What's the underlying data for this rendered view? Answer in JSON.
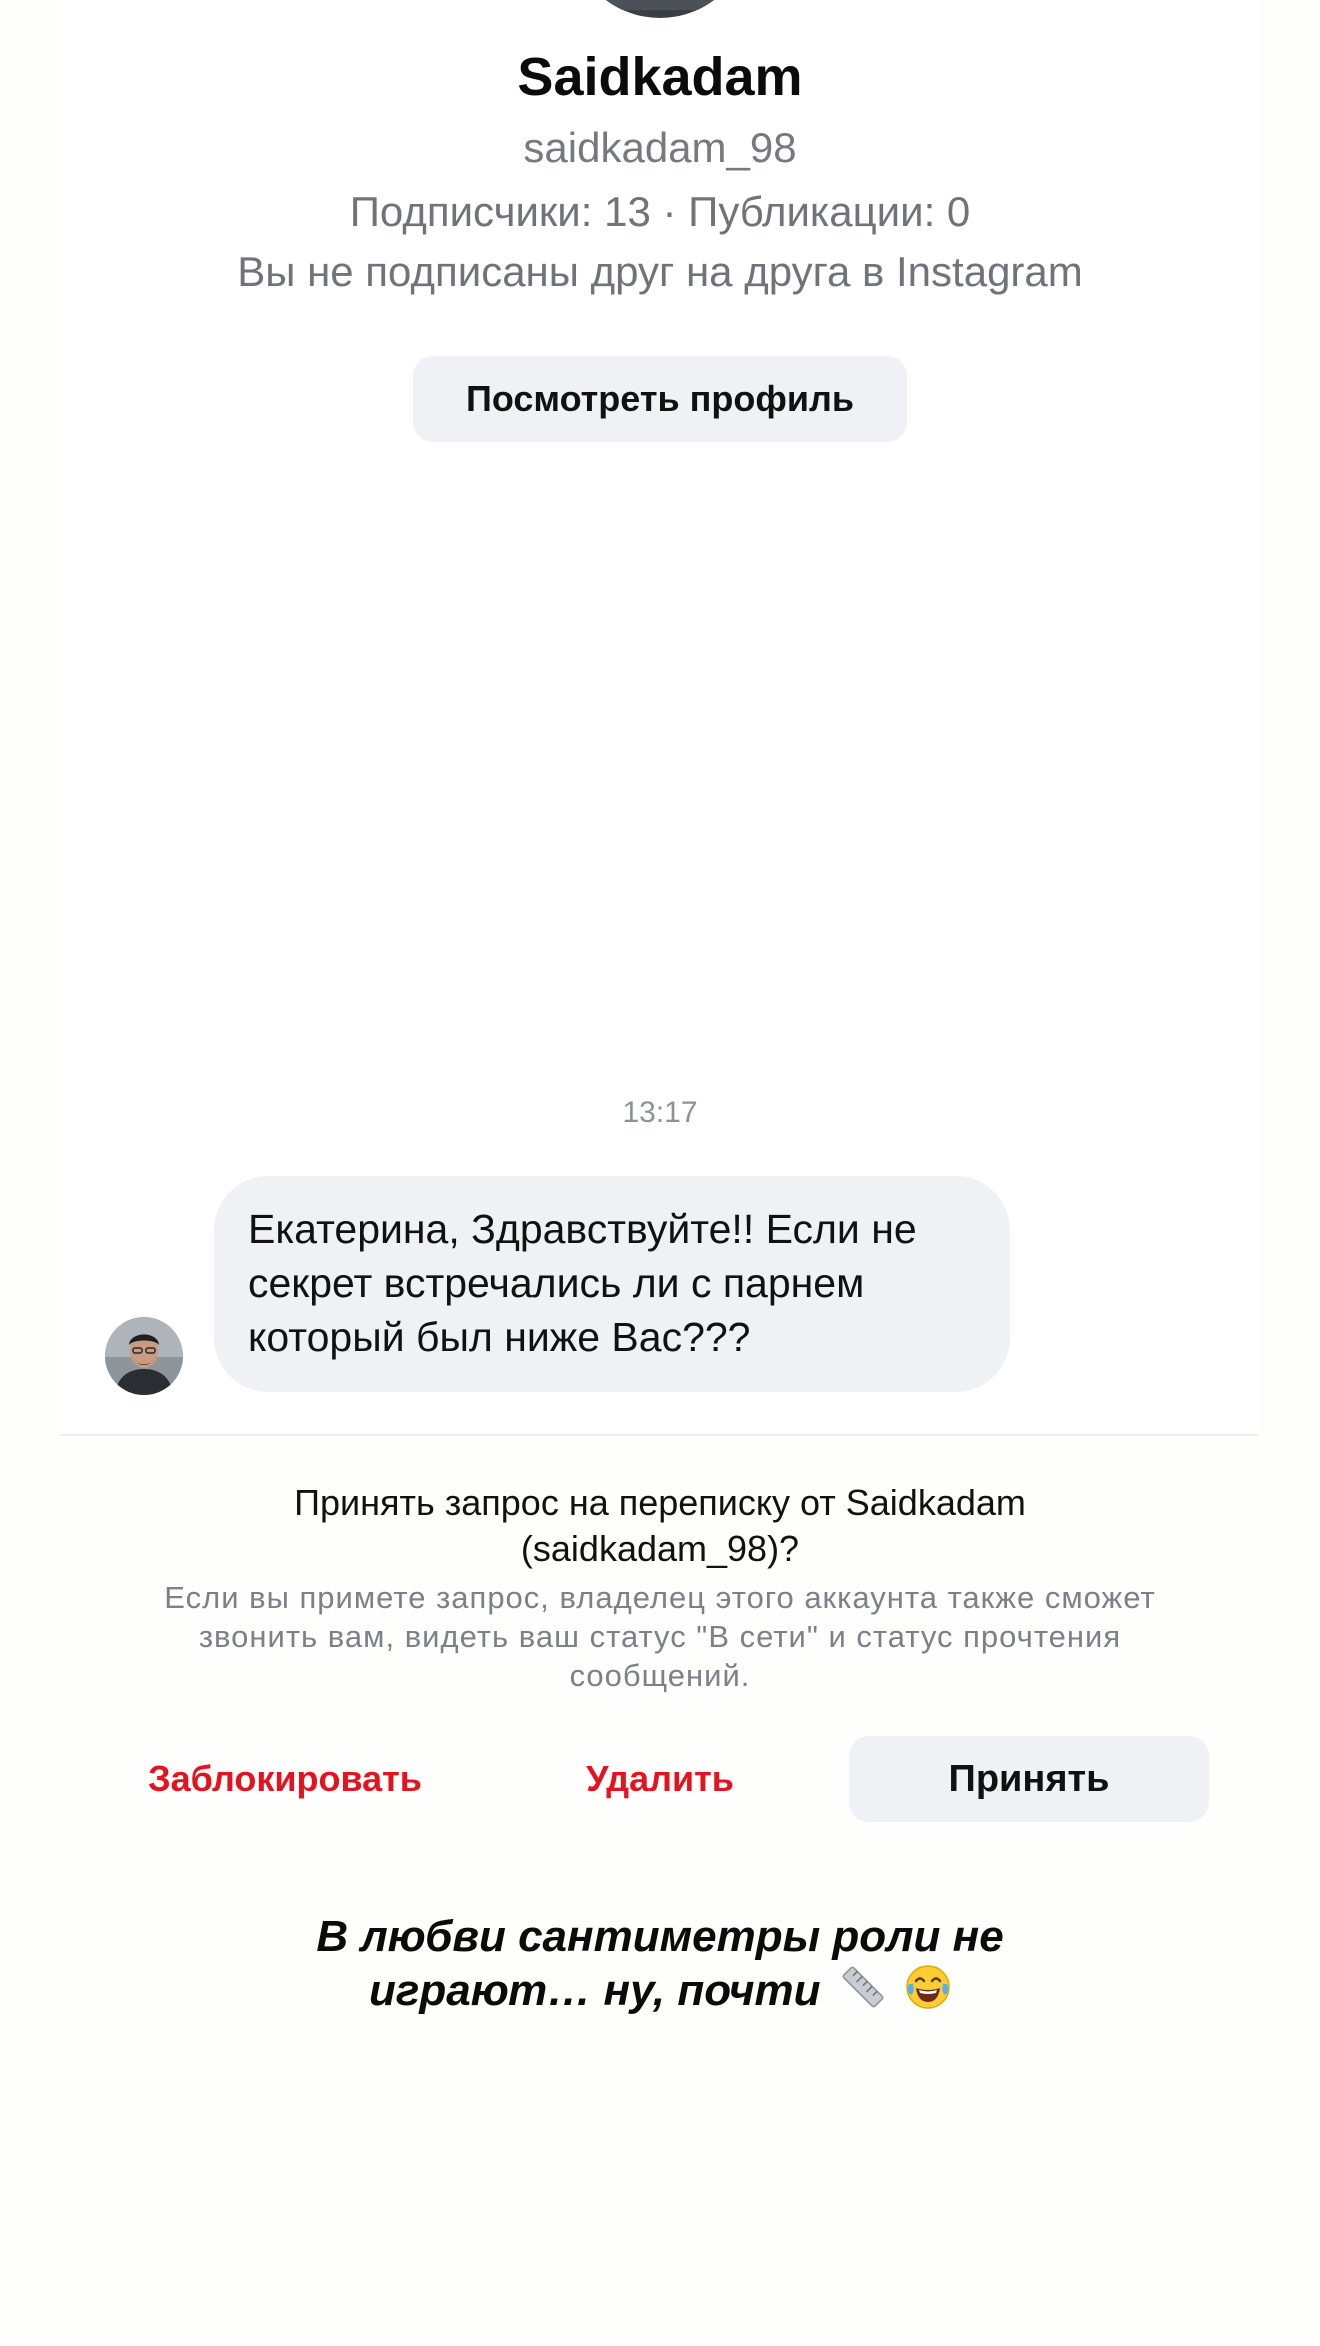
{
  "profile": {
    "name": "Saidkadam",
    "username": "saidkadam_98",
    "stats": "Подписчики: 13 · Публикации: 0",
    "relationship_note": "Вы не подписаны друг на друга в Instagram",
    "view_profile_label": "Посмотреть профиль"
  },
  "conversation": {
    "timestamp": "13:17",
    "message_lines": [
      "Екатерина, Здравствуйте!! Если не",
      "секрет встречались ли с парнем",
      "который был ниже Вас???"
    ]
  },
  "request": {
    "title_lines": [
      "Принять запрос на переписку от Saidkadam",
      "(saidkadam_98)?"
    ],
    "description_lines": [
      "Если вы примете запрос, владелец этого аккаунта также сможет",
      "звонить вам, видеть ваш статус \"В сети\" и статус прочтения",
      "сообщений."
    ],
    "block_label": "Заблокировать",
    "delete_label": "Удалить",
    "accept_label": "Принять"
  },
  "caption": {
    "lines": [
      "В любви сантиметры роли не",
      "играют… ну, почти"
    ],
    "emoji": [
      "ruler-icon",
      "laughing-tears-icon"
    ]
  },
  "colors": {
    "destructive": "#e3141f",
    "secondary_text": "#767a80",
    "button_bg": "#eff1f4"
  }
}
